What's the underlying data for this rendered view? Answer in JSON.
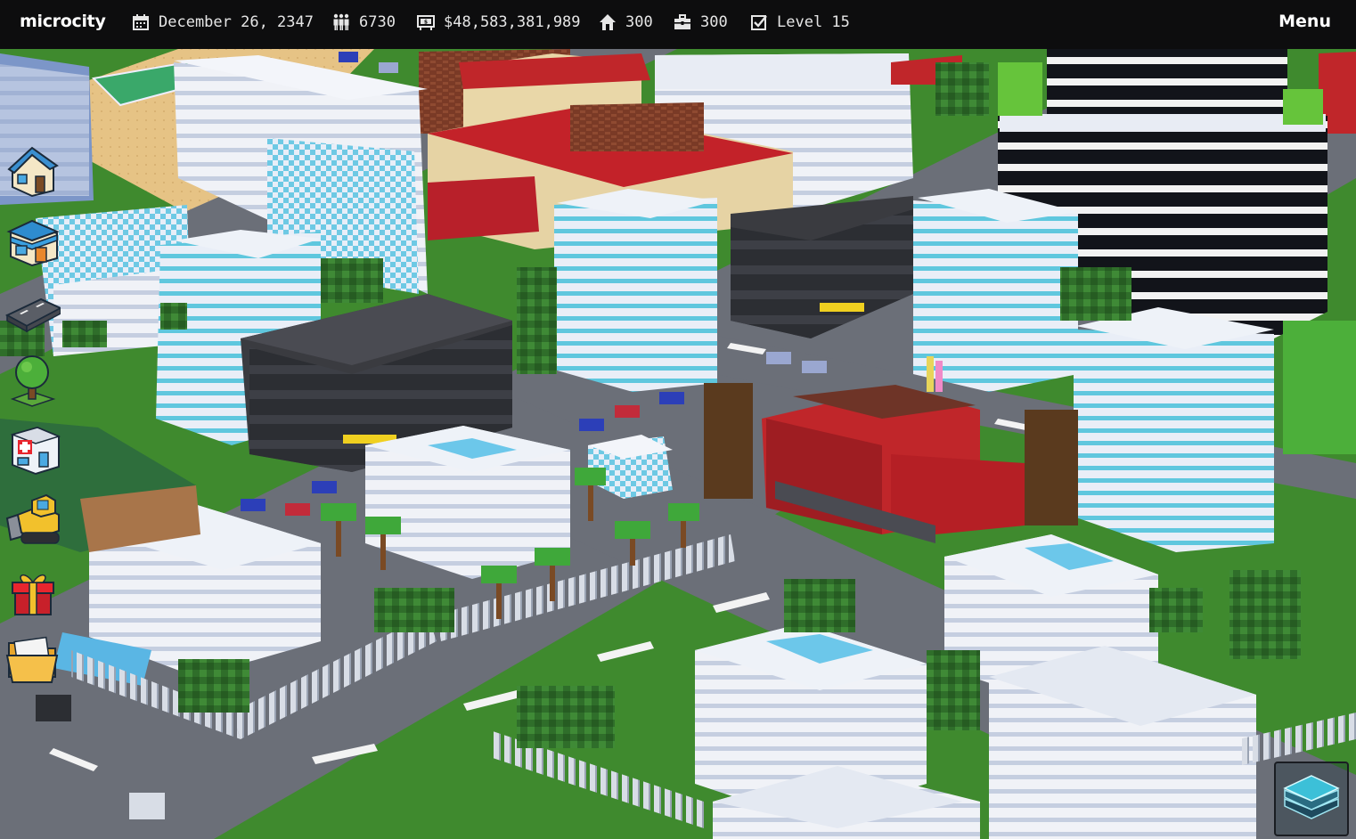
{
  "app": {
    "title": "microcity"
  },
  "stats": {
    "date": "December 26, 2347",
    "population": "6730",
    "money": "$48,583,381,989",
    "residential": "300",
    "jobs": "300",
    "level": "Level 15"
  },
  "menu": {
    "label": "Menu"
  },
  "icons": {
    "date": "calendar-icon",
    "population": "people-icon",
    "money": "money-icon",
    "residential": "house-icon",
    "jobs": "briefcase-icon",
    "level": "checkbox-icon"
  },
  "tools": [
    {
      "name": "residential-tool",
      "icon": "house-icon"
    },
    {
      "name": "commercial-tool",
      "icon": "shop-icon"
    },
    {
      "name": "road-tool",
      "icon": "road-icon"
    },
    {
      "name": "tree-tool",
      "icon": "tree-icon"
    },
    {
      "name": "hospital-tool",
      "icon": "hospital-icon"
    },
    {
      "name": "bulldozer-tool",
      "icon": "bulldozer-icon"
    },
    {
      "name": "gift-tool",
      "icon": "gift-icon"
    },
    {
      "name": "files-tool",
      "icon": "folder-icon"
    }
  ],
  "layers": {
    "icon": "layers-icon"
  },
  "colors": {
    "topbar": "#0d0d0e",
    "grass": "#3f8a2e",
    "road": "#6b6f78",
    "roof_red": "#c0262a",
    "glass_cyan": "#5fc7de"
  }
}
